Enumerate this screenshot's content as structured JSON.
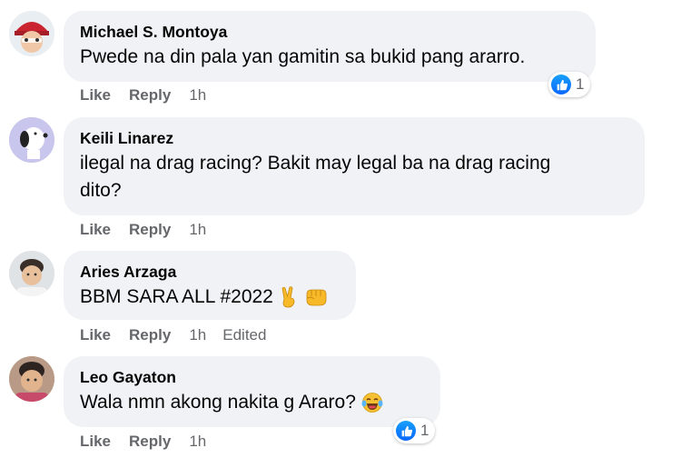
{
  "comments": [
    {
      "author": "Michael S. Montoya",
      "text": "Pwede na din pala yan gamitin sa bukid pang ararro.",
      "like": "Like",
      "reply": "Reply",
      "time": "1h",
      "reaction_count": "1",
      "avatar": "avatar-red-hat"
    },
    {
      "author": "Keili Linarez",
      "text_line1": "ilegal na drag racing? Bakit may legal ba na drag racing",
      "text_line2": "dito?",
      "like": "Like",
      "reply": "Reply",
      "time": "1h",
      "avatar": "avatar-snoopy"
    },
    {
      "author": "Aries Arzaga",
      "text": "BBM SARA ALL #2022",
      "emojis": [
        "victory-hand-emoji",
        "fist-emoji"
      ],
      "like": "Like",
      "reply": "Reply",
      "time": "1h",
      "edited": "Edited",
      "avatar": "avatar-person"
    },
    {
      "author": "Leo Gayaton",
      "text": "Wala nmn akong nakita g Araro?",
      "emojis": [
        "laughing-tears-emoji"
      ],
      "like": "Like",
      "reply": "Reply",
      "time": "1h",
      "reaction_count": "1",
      "avatar": "avatar-child"
    }
  ],
  "colors": {
    "bubble": "#f0f2f5",
    "meta_text": "#65676b",
    "like_blue": "#0866ff"
  }
}
